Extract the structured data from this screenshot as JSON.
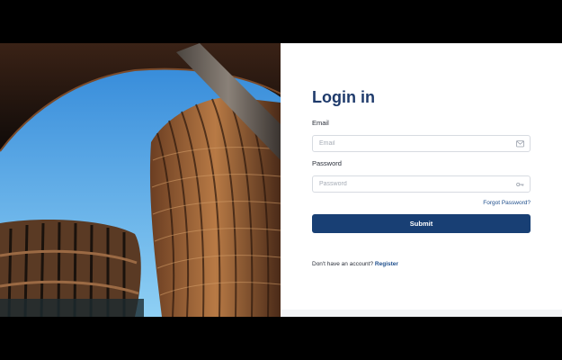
{
  "login": {
    "title": "Login in",
    "email_label": "Email",
    "email_placeholder": "Email",
    "email_value": "",
    "password_label": "Password",
    "password_placeholder": "Password",
    "password_value": "",
    "forgot_password": "Forgot Password?",
    "submit_label": "Submit",
    "register_prompt": "Don't have an account?",
    "register_link": "Register"
  },
  "icons": {
    "email_field_icon": "envelope-icon",
    "password_field_icon": "key-icon"
  },
  "colors": {
    "brand": "#183f74",
    "title": "#1e3a6b",
    "link": "#1e4e8c",
    "background": "#000000",
    "panel": "#ffffff"
  }
}
